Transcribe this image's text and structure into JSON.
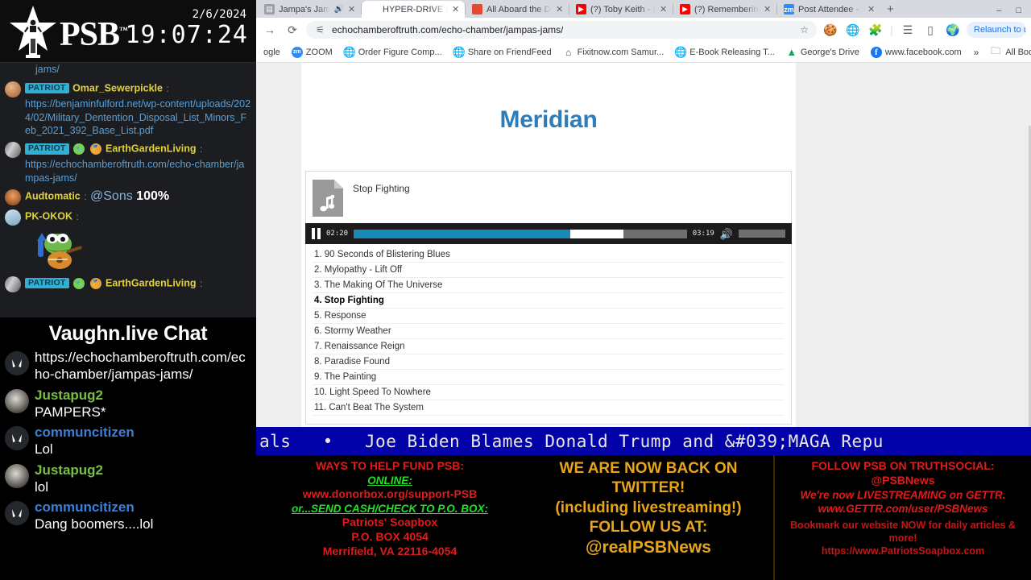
{
  "overlay": {
    "brand_word": "PSB",
    "date": "2/6/2024",
    "time": "19:07:24",
    "star_icon": "psb-star-logo"
  },
  "chat_top": {
    "partial_link_top": "jams/",
    "messages": [
      {
        "badge": "PATRIOT",
        "username": "Omar_Sewerpickle",
        "colon": ":",
        "link": "https://benjaminfulford.net/wp-content/uploads/2024/02/Military_Dentention_Disposal_List_Minors_Feb_2021_392_Base_List.pdf"
      },
      {
        "badge": "PATRIOT",
        "username": "EarthGardenLiving",
        "colon": ":",
        "link": "https://echochamberoftruth.com/echo-chamber/jampas-jams/"
      },
      {
        "username": "Audtomatic",
        "colon": ":",
        "mention": "@Sons",
        "text": "100%"
      },
      {
        "username": "PK-OKOK",
        "colon": ":",
        "emote": "pepe-guitar-emote"
      },
      {
        "badge": "PATRIOT",
        "username": "EarthGardenLiving",
        "colon": ":"
      }
    ]
  },
  "chat_bottom": {
    "title": "Vaughn.live Chat",
    "messages": [
      {
        "username": "",
        "text": "https://echochamberoftruth.com/echo-chamber/jampas-jams/"
      },
      {
        "username": "Justapug2",
        "text": "PAMPERS*"
      },
      {
        "username": "communcitizen",
        "text": "Lol"
      },
      {
        "username": "Justapug2",
        "text": "lol"
      },
      {
        "username": "communcitizen",
        "text": "Dang boomers....lol"
      }
    ]
  },
  "browser": {
    "tabs": [
      {
        "title": "Jampa's Jams – E",
        "favicon": "page-icon",
        "audio": true,
        "active": false
      },
      {
        "title": "HYPER-DRIVE MOND",
        "favicon": "play-icon",
        "audio": false,
        "active": true
      },
      {
        "title": "All Aboard the Disea",
        "favicon": "red-icon",
        "audio": false,
        "active": false
      },
      {
        "title": "(?) Toby Keith - Don",
        "favicon": "youtube-icon",
        "audio": false,
        "active": false
      },
      {
        "title": "(?) Remembering To",
        "favicon": "youtube-icon",
        "audio": false,
        "active": false
      },
      {
        "title": "Post Attendee - Zoo",
        "favicon": "zoom-icon",
        "audio": false,
        "active": false
      }
    ],
    "new_tab_label": "+",
    "window_controls": {
      "minimize": "–",
      "maximize": "□"
    },
    "toolbar": {
      "back_icon": "back-arrow-icon",
      "forward_icon": "forward-arrow-icon",
      "reload_icon": "reload-icon",
      "site_info_icon": "tune-icon",
      "url": "echochamberoftruth.com/echo-chamber/jampas-jams/",
      "bookmark_icon": "star-icon",
      "ext_icons": [
        "cookie-extension-icon",
        "globe-extension-icon",
        "puzzle-extension-icon"
      ],
      "reading_list_icon": "reading-list-icon",
      "side_panel_icon": "side-panel-icon",
      "profile_icon": "profile-avatar-icon",
      "relaunch_label": "Relaunch to upda"
    },
    "bookmarks": [
      {
        "label": "ogle",
        "favicon": "partial-icon"
      },
      {
        "label": "ZOOM",
        "favicon": "zoom-icon"
      },
      {
        "label": "Order Figure Comp...",
        "favicon": "globe-icon"
      },
      {
        "label": "Share on FriendFeed",
        "favicon": "globe-icon"
      },
      {
        "label": "Fixitnow.com Samur...",
        "favicon": "fixitnow-icon"
      },
      {
        "label": "E-Book Releasing T...",
        "favicon": "globe-icon"
      },
      {
        "label": "George's Drive",
        "favicon": "drive-icon"
      },
      {
        "label": "www.facebook.com",
        "favicon": "facebook-icon"
      }
    ],
    "bookmarks_overflow": "»",
    "all_bookmarks_label": "All Book",
    "all_bookmarks_icon": "folder-icon"
  },
  "page": {
    "title": "Meridian",
    "player": {
      "album_art_icon": "music-file-icon",
      "now_playing": "Stop Fighting",
      "pause_icon": "pause-icon",
      "current_time": "02:20",
      "duration": "03:19",
      "speaker_icon": "speaker-icon",
      "progress_percent": 65,
      "buffer_percent": 81,
      "volume_percent": 88
    },
    "tracks": [
      "1. 90 Seconds of Blistering Blues",
      "2. Mylopathy - Lift Off",
      "3. The Making Of The Universe",
      "4. Stop Fighting",
      "5. Response",
      "6. Stormy Weather",
      "7. Renaissance Reign",
      "8. Paradise Found",
      "9. The Painting",
      "10. Light Speed To Nowhere",
      "11. Can't Beat The System"
    ],
    "current_track_index": 3
  },
  "ticker": {
    "fragment": "als",
    "bullet": "•",
    "headline": "Joe Biden Blames Donald Trump and &#039;MAGA Repu"
  },
  "promo": {
    "left": {
      "line1": "WAYS TO HELP FUND PSB:",
      "line2": "ONLINE:",
      "line3": "www.donorbox.org/support-PSB",
      "line4": "or...SEND CASH/CHECK TO P.O. BOX:",
      "line5": "Patriots' Soapbox",
      "line6": "P.O. BOX 4054",
      "line7": "Merrifield, VA 22116-4054"
    },
    "center": {
      "line1": "WE ARE NOW BACK ON TWITTER!",
      "line2": "(including livestreaming!)",
      "line3": "FOLLOW US AT:",
      "line4": "@realPSBNews"
    },
    "right": {
      "line1": "FOLLOW PSB ON TRUTHSOCIAL:",
      "line2": "@PSBNews",
      "line3": "We're now LIVESTREAMING on GETTR.",
      "line4": "www.GETTR.com/user/PSBNews",
      "line5": "Bookmark our website NOW for daily articles & more!",
      "line6": "https://www.PatriotsSoapbox.com"
    }
  },
  "colors": {
    "accent_blue": "#2e7cb8",
    "ticker_bg": "#0202a8",
    "patriot_badge": "#31b0d5",
    "promo_red": "#e01b1b",
    "promo_amber": "#e8a51b",
    "promo_green": "#22e022"
  }
}
